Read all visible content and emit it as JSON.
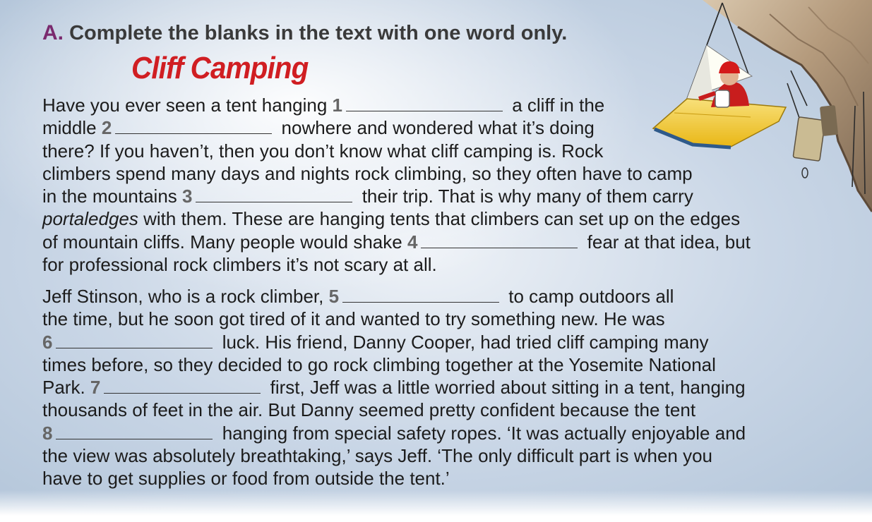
{
  "exercise": {
    "letter": "A.",
    "instruction": "Complete the blanks in the text with one word only.",
    "title": "Cliff Camping"
  },
  "paragraph1": {
    "l1a": "Have you ever seen a tent hanging ",
    "l1n": "1",
    "l1b": " a cliff in the",
    "l2a": "middle ",
    "l2n": "2",
    "l2b": " nowhere and wondered what it’s doing",
    "l3": "there? If you haven’t, then you don’t know what cliff camping is. Rock",
    "l4": "climbers spend many days and nights rock climbing, so they often have to camp",
    "l5a": "in the mountains ",
    "l5n": "3",
    "l5b": " their trip. That is why many of them carry",
    "l6i": "portaledges",
    "l6b": " with them. These are hanging tents that climbers can set up on the edges",
    "l7a": "of mountain cliffs. Many people would shake ",
    "l7n": "4",
    "l7b": " fear at that idea, but",
    "l8": "for professional rock climbers it’s not scary at all."
  },
  "paragraph2": {
    "l1a": "Jeff Stinson, who is a rock climber, ",
    "l1n": "5",
    "l1b": " to camp outdoors all",
    "l2": "the time, but he soon got tired of it and wanted to try something new. He was",
    "l3n": "6",
    "l3b": " luck. His friend, Danny Cooper, had tried cliff camping many",
    "l4": "times before, so they decided to go rock climbing together at the Yosemite National",
    "l5a": "Park. ",
    "l5n": "7",
    "l5b": " first, Jeff was a little worried about sitting in a tent, hanging",
    "l6": "thousands of feet in the air. But Danny seemed pretty confident because the tent",
    "l7n": "8",
    "l7b": " hanging from special safety ropes. ‘It was actually enjoyable and",
    "l8": "the view was absolutely breathtaking,’ says Jeff. ‘The only difficult part is when you",
    "l9": "have to get supplies or food from outside the tent.’"
  },
  "colors": {
    "title": "#d01e22",
    "letter": "#7a2a6e",
    "number": "#666666",
    "tent": "#f2cf36",
    "helmet": "#d41a1a"
  }
}
